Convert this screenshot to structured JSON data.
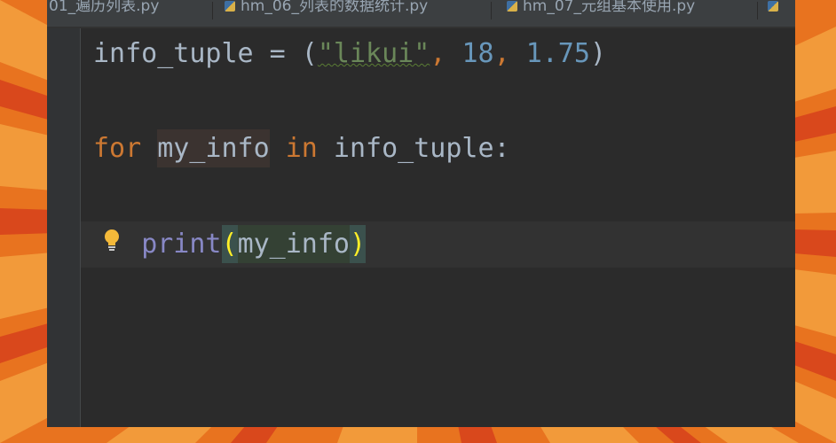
{
  "tabs": [
    {
      "label": "01_遍历列表.py"
    },
    {
      "label": "hm_06_列表的数据统计.py"
    },
    {
      "label": "hm_07_元组基本使用.py"
    },
    {
      "label": ""
    }
  ],
  "code": {
    "line1": {
      "var": "info_tuple",
      "assign": " = (",
      "string": "\"likui\"",
      "comma1": ", ",
      "num1": "18",
      "comma2": ", ",
      "num2": "1.75",
      "close": ")"
    },
    "line2": {
      "kw_for": "for",
      "sp1": " ",
      "loop_var": "my_info",
      "sp2": " ",
      "kw_in": "in",
      "iterable": " info_tuple:"
    },
    "line3": {
      "indent": "   ",
      "func": "print",
      "open": "(",
      "arg": "my_info",
      "close": ")"
    }
  },
  "colors": {
    "keyword": "#cc7832",
    "string": "#6a8759",
    "number": "#6897bb",
    "builtin": "#8888c6",
    "default": "#a9b7c6",
    "background": "#2b2b2b",
    "backdrop": "#e8731f"
  },
  "icons": {
    "intention_bulb": "lightbulb-icon",
    "file_type": "python-file-icon"
  }
}
